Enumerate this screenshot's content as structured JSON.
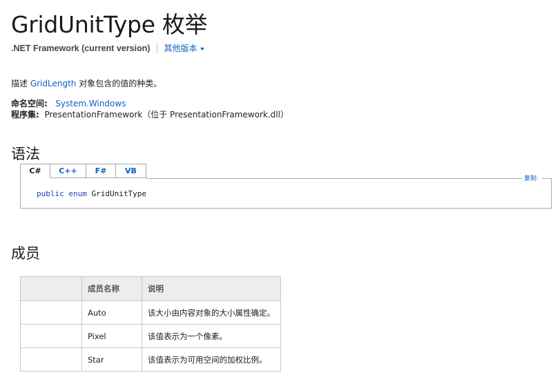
{
  "page": {
    "title": "GridUnitType 枚举",
    "version": {
      "current": ".NET Framework (current version)",
      "other": "其他版本"
    },
    "description": {
      "prefix": "描述 ",
      "link": "GridLength",
      "suffix": " 对象包含的值的种类。"
    },
    "namespace": {
      "label": "命名空间:",
      "value": "System.Windows"
    },
    "assembly": {
      "label": "程序集:",
      "value": "PresentationFramework（位于 PresentationFramework.dll）"
    }
  },
  "syntax": {
    "heading": "语法",
    "tabs": [
      "C#",
      "C++",
      "F#",
      "VB"
    ],
    "active_tab": "C#",
    "copy_label": "复制",
    "code": {
      "kw1": "public",
      "kw2": "enum",
      "name": "GridUnitType"
    }
  },
  "members": {
    "heading": "成员",
    "headers": [
      "",
      "成员名称",
      "说明"
    ],
    "rows": [
      {
        "icon": "",
        "name": "Auto",
        "desc": "该大小由内容对象的大小属性确定。"
      },
      {
        "icon": "",
        "name": "Pixel",
        "desc": "该值表示为一个像素。"
      },
      {
        "icon": "",
        "name": "Star",
        "desc": "该值表示为可用空间的加权比例。"
      }
    ]
  },
  "colors": {
    "link": "#0a62c3",
    "keyword": "#1d3fbf",
    "table_header_bg": "#ededed",
    "border": "#a9a9a9"
  }
}
